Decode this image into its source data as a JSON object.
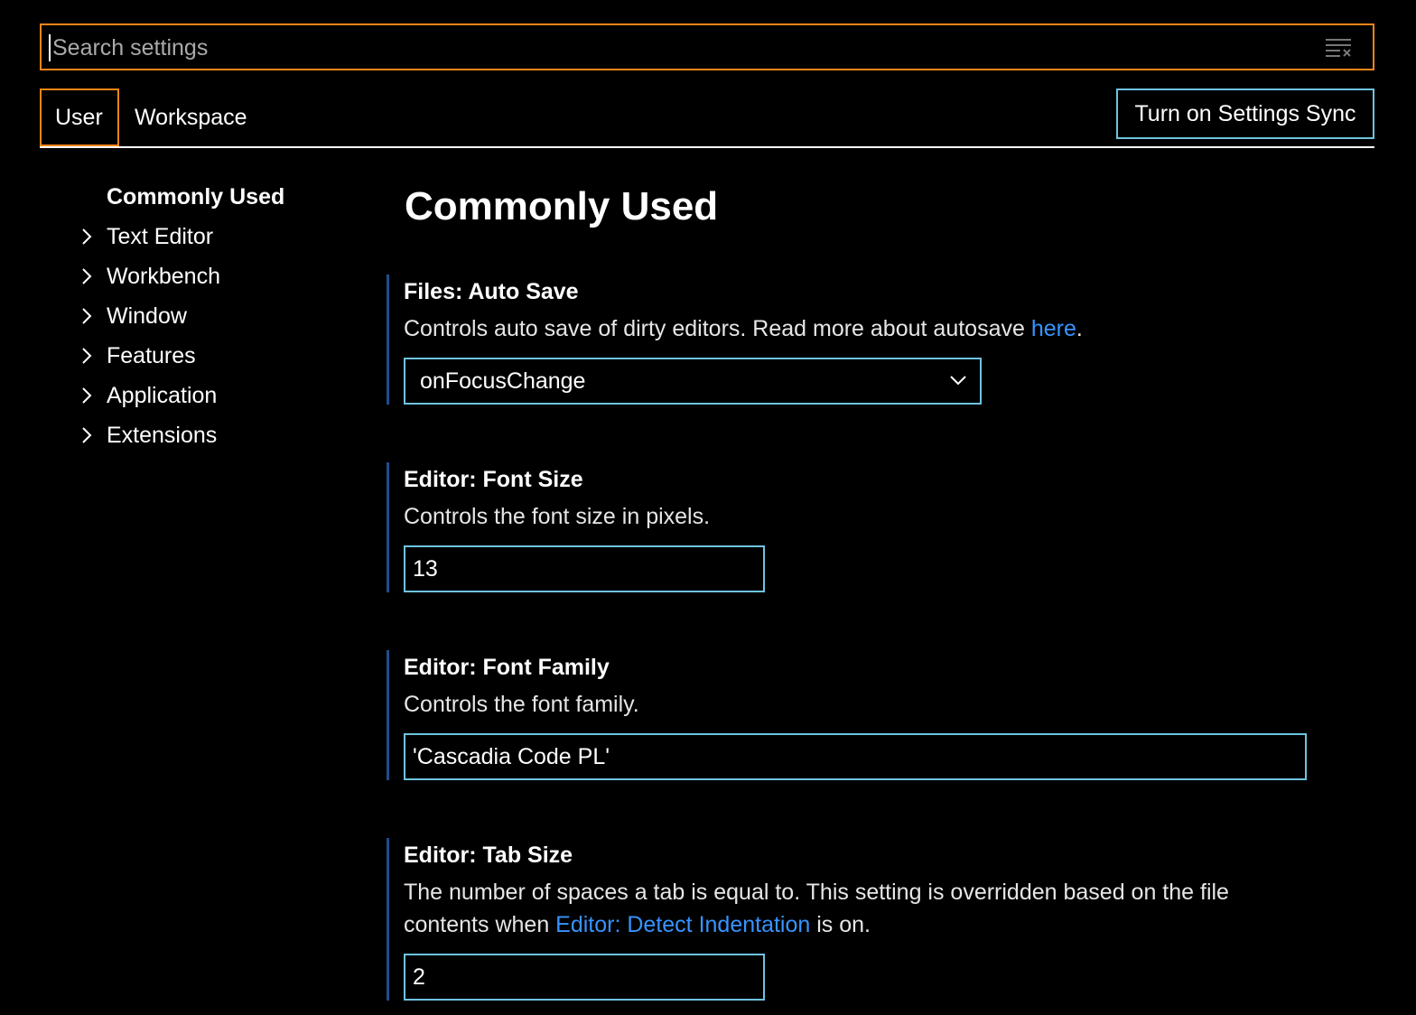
{
  "search": {
    "placeholder": "Search settings",
    "clear_icon": "clear-filter-icon"
  },
  "tabs": [
    {
      "label": "User",
      "active": true
    },
    {
      "label": "Workspace",
      "active": false
    }
  ],
  "sync_button": {
    "label": "Turn on Settings Sync"
  },
  "toc": {
    "items": [
      {
        "label": "Commonly Used",
        "active": true
      },
      {
        "label": "Text Editor"
      },
      {
        "label": "Workbench"
      },
      {
        "label": "Window"
      },
      {
        "label": "Features"
      },
      {
        "label": "Application"
      },
      {
        "label": "Extensions"
      }
    ]
  },
  "main": {
    "title": "Commonly Used",
    "settings": [
      {
        "category": "Files: ",
        "name": "Auto Save",
        "desc_before": "Controls auto save of dirty editors. Read more about autosave ",
        "desc_link": "here",
        "desc_after": ".",
        "control": "select",
        "value": "onFocusChange"
      },
      {
        "category": "Editor: ",
        "name": "Font Size",
        "desc": "Controls the font size in pixels.",
        "control": "input",
        "value": "13"
      },
      {
        "category": "Editor: ",
        "name": "Font Family",
        "desc": "Controls the font family.",
        "control": "input",
        "value": "'Cascadia Code PL'"
      },
      {
        "category": "Editor: ",
        "name": "Tab Size",
        "desc_line1": "The number of spaces a tab is equal to. This setting is overridden based on the file",
        "desc_before": "contents when ",
        "desc_link": "Editor: Detect Indentation",
        "desc_after": " is on.",
        "control": "input",
        "value": "2"
      }
    ]
  },
  "colors": {
    "focus_border": "#f38518",
    "contrast_border": "#6fc3df",
    "link": "#3794ff",
    "setting_indicator": "#1e4e8c",
    "background": "#000000"
  }
}
